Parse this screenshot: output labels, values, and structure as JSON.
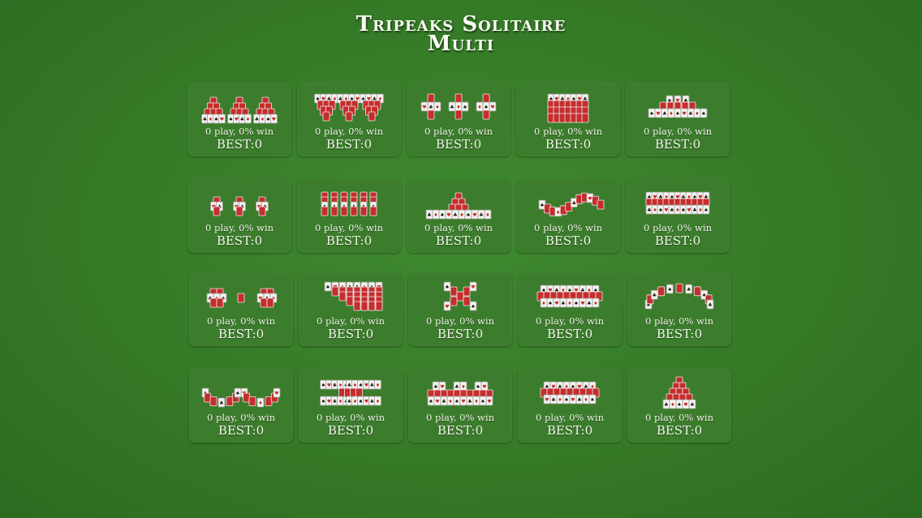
{
  "title": {
    "line1": "Tripeaks Solitaire",
    "line2": "Multi"
  },
  "layouts": [
    {
      "id": "three-peaks",
      "stats": "0 play, 0% win",
      "best": "BEST:0"
    },
    {
      "id": "inverted-peaks",
      "stats": "0 play, 0% win",
      "best": "BEST:0"
    },
    {
      "id": "three-crosses",
      "stats": "0 play, 0% win",
      "best": "BEST:0"
    },
    {
      "id": "block",
      "stats": "0 play, 0% win",
      "best": "BEST:0"
    },
    {
      "id": "wide-peaks",
      "stats": "0 play, 0% win",
      "best": "BEST:0"
    },
    {
      "id": "three-diamonds",
      "stats": "0 play, 0% win",
      "best": "BEST:0"
    },
    {
      "id": "columns",
      "stats": "0 play, 0% win",
      "best": "BEST:0"
    },
    {
      "id": "mountain",
      "stats": "0 play, 0% win",
      "best": "BEST:0"
    },
    {
      "id": "snake",
      "stats": "0 play, 0% win",
      "best": "BEST:0"
    },
    {
      "id": "wide-rows",
      "stats": "0 play, 0% win",
      "best": "BEST:0"
    },
    {
      "id": "two-clusters",
      "stats": "0 play, 0% win",
      "best": "BEST:0"
    },
    {
      "id": "staircase",
      "stats": "0 play, 0% win",
      "best": "BEST:0"
    },
    {
      "id": "x-cross",
      "stats": "0 play, 0% win",
      "best": "BEST:0"
    },
    {
      "id": "big-block",
      "stats": "0 play, 0% win",
      "best": "BEST:0"
    },
    {
      "id": "arch",
      "stats": "0 play, 0% win",
      "best": "BEST:0"
    },
    {
      "id": "two-arcs",
      "stats": "0 play, 0% win",
      "best": "BEST:0"
    },
    {
      "id": "ladder",
      "stats": "0 play, 0% win",
      "best": "BEST:0"
    },
    {
      "id": "castle",
      "stats": "0 play, 0% win",
      "best": "BEST:0"
    },
    {
      "id": "tower",
      "stats": "0 play, 0% win",
      "best": "BEST:0"
    },
    {
      "id": "pyramid",
      "stats": "0 play, 0% win",
      "best": "BEST:0"
    }
  ],
  "colors": {
    "card_back": "#c62d2d",
    "card_face": "#f4f4f0",
    "tile": "#3b7d2c"
  }
}
